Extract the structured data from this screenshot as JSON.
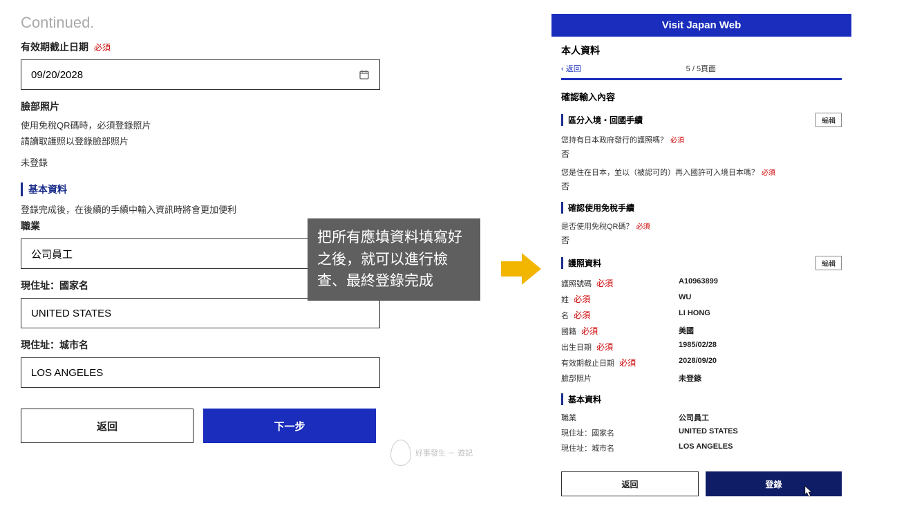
{
  "continued": "Continued.",
  "left": {
    "expiry_label": "有效期截止日期",
    "expiry_value": "09/20/2028",
    "face_label": "臉部照片",
    "face_help1": "使用免稅QR碼時，必須登錄照片",
    "face_help2": "請讀取護照以登錄臉部照片",
    "face_status": "未登錄",
    "basic_head": "基本資料",
    "basic_help": "登錄完成後，在後續的手續中輸入資訊時將會更加便利",
    "occupation_label": "職業",
    "occupation_value": "公司員工",
    "country_label": "現住址：國家名",
    "country_value": "UNITED STATES",
    "city_label": "現住址：城市名",
    "city_value": "LOS ANGELES",
    "back_btn": "返回",
    "next_btn": "下一步"
  },
  "required_text": "必須",
  "overlay": "把所有應填資料填寫好之後，就可以進行檢查、最終登錄完成",
  "watermark": "好事發生 － 遊記",
  "right": {
    "header": "Visit Japan Web",
    "page_title": "本人資料",
    "back_link": "返回",
    "progress": "5 / 5頁面",
    "confirm_title": "確認輸入內容",
    "sec1_title": "區分入境・回國手續",
    "edit_btn": "編輯",
    "q1": "您持有日本政府發行的護照嗎？",
    "a1": "否",
    "q2": "您是住在日本，並以（被認可的）再入國許可入境日本嗎？",
    "a2": "否",
    "sec2_title": "確認使用免稅手續",
    "q3": "是否使用免稅QR碼？",
    "a3": "否",
    "sec3_title": "護照資料",
    "passport_no_label": "護照號碼",
    "passport_no_value": "A10963899",
    "surname_label": "姓",
    "surname_value": "WU",
    "given_label": "名",
    "given_value": "LI HONG",
    "nationality_label": "國籍",
    "nationality_value": "美國",
    "dob_label": "出生日期",
    "dob_value": "1985/02/28",
    "expiry_label": "有效期截止日期",
    "expiry_value": "2028/09/20",
    "face_label": "臉部照片",
    "face_value": "未登錄",
    "sec4_title": "基本資料",
    "occ_label": "職業",
    "occ_value": "公司員工",
    "country_label": "現住址：國家名",
    "country_value": "UNITED STATES",
    "city_label": "現住址：城市名",
    "city_value": "LOS ANGELES",
    "back_btn": "返回",
    "register_btn": "登錄"
  }
}
